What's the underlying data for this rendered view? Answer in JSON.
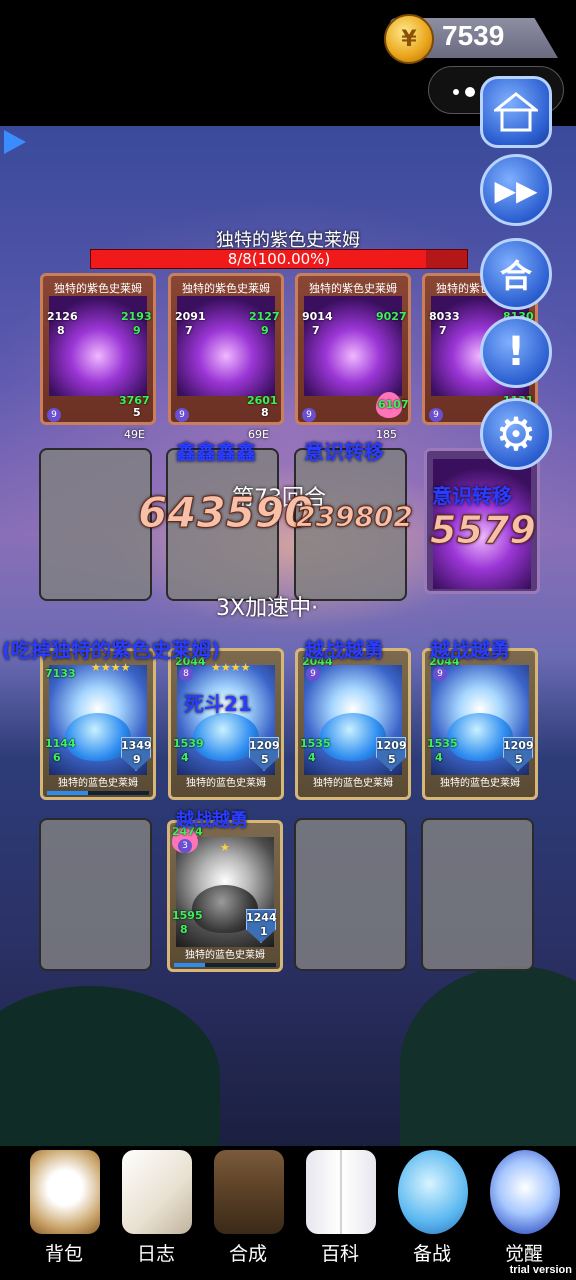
{
  "currency": {
    "icon": "gold-coin-icon",
    "value": "7539"
  },
  "boss": {
    "name": "独特的紫色史莱姆",
    "hp_text": "8/8(100.00%)",
    "hp_fraction": 1.0
  },
  "enemies": [
    {
      "title": "独特的紫色史莱姆",
      "atk": "2126",
      "atk_lvl": "8",
      "def": "2193",
      "def_lvl": "9",
      "hp": "3767",
      "hp_lvl": "5",
      "level": "9"
    },
    {
      "title": "独特的紫色史莱姆",
      "atk": "2091",
      "atk_lvl": "7",
      "def": "2127",
      "def_lvl": "9",
      "hp": "2601",
      "hp_lvl": "8",
      "level": "9"
    },
    {
      "title": "独特的紫色史莱姆",
      "atk": "9014",
      "atk_lvl": "7",
      "def": "9027",
      "def_lvl": "",
      "hp": "6107",
      "hp_lvl": "",
      "level": "9"
    },
    {
      "title": "独特的紫色史莱姆",
      "atk": "8033",
      "atk_lvl": "7",
      "def": "8130",
      "def_lvl": "",
      "hp": "1131",
      "hp_lvl": "",
      "level": "9"
    }
  ],
  "allies": [
    {
      "title": "独特的蓝色史莱姆",
      "atk": "1144",
      "atk_lvl": "6",
      "def": "1349",
      "def_lvl": "9",
      "hp": "7133",
      "level": "9"
    },
    {
      "title": "独特的蓝色史莱姆",
      "atk": "1539",
      "atk_lvl": "4",
      "def": "1209",
      "def_lvl": "5",
      "hp": "2044",
      "level": "8"
    },
    {
      "title": "独特的蓝色史莱姆",
      "atk": "1535",
      "atk_lvl": "4",
      "def": "1209",
      "def_lvl": "5",
      "hp": "2044",
      "level": "9"
    },
    {
      "title": "独特的蓝色史莱姆",
      "atk": "1535",
      "atk_lvl": "4",
      "def": "1209",
      "def_lvl": "5",
      "hp": "2044",
      "level": "9"
    }
  ],
  "reserve": {
    "title": "独特的蓝色史莱姆",
    "atk": "1595",
    "atk_lvl": "8",
    "def": "1244",
    "def_lvl": "1",
    "hp": "2474",
    "level": "3"
  },
  "battle": {
    "round_text": "第73回合",
    "speed_text": "3X加速中·",
    "damage_big": "643590",
    "damage_small": "239802",
    "damage_card": "5579",
    "effects": {
      "consciousness_1": "意识转移",
      "consciousness_2": "意识转移",
      "eat_text": "(吃掉独特的紫色史莱姆)",
      "brave_1": "越战越勇",
      "brave_2": "越战越勇",
      "brave_3": "越战越勇",
      "duel": "死斗21",
      "garbled": "鑫鑫鑫鑫",
      "small_num_1": "49E",
      "small_num_2": "69E",
      "small_num_3": "185"
    }
  },
  "side_buttons": [
    {
      "name": "home-button",
      "label": ""
    },
    {
      "name": "fast-forward-button",
      "label": "▶▶"
    },
    {
      "name": "merge-button",
      "label": "合"
    },
    {
      "name": "alert-button",
      "label": "!"
    },
    {
      "name": "settings-button",
      "label": "⚙"
    }
  ],
  "nav": [
    {
      "label": "背包",
      "icon": "backpack-icon"
    },
    {
      "label": "日志",
      "icon": "journal-icon"
    },
    {
      "label": "合成",
      "icon": "workbench-icon"
    },
    {
      "label": "百科",
      "icon": "book-icon"
    },
    {
      "label": "备战",
      "icon": "slime-icon"
    },
    {
      "label": "觉醒",
      "icon": "awaken-icon"
    }
  ],
  "watermark": "trial version"
}
